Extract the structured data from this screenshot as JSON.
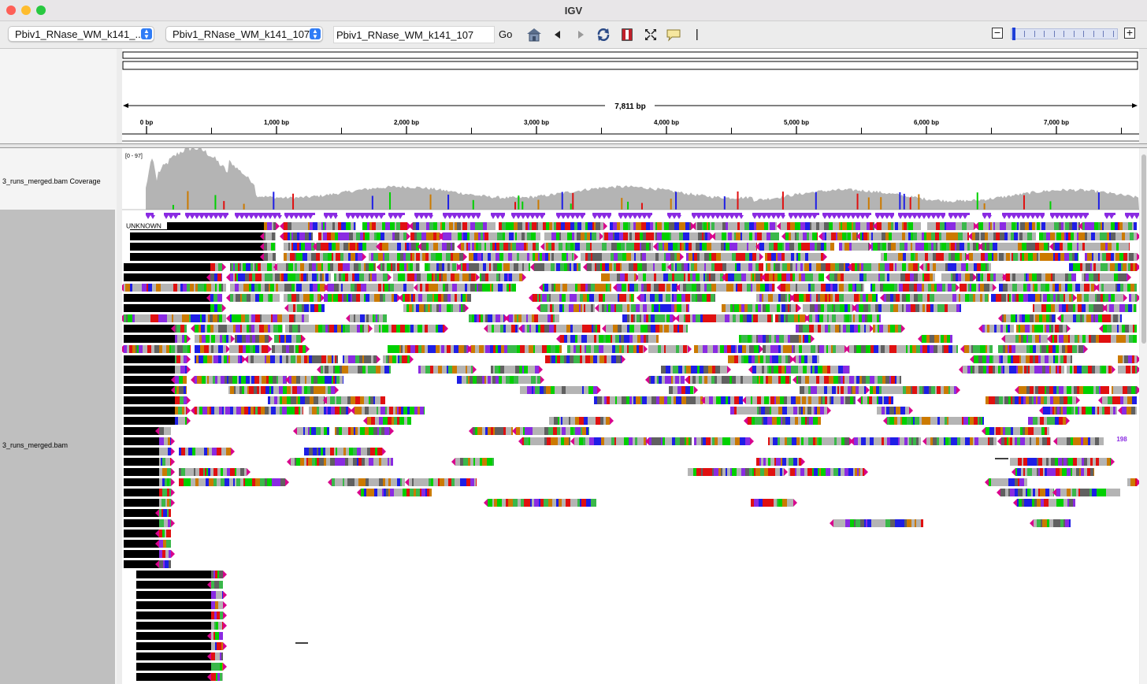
{
  "window": {
    "title": "IGV",
    "traffic_lights": {
      "close": "#fe5f57",
      "minimize": "#febc2e",
      "zoom": "#28c840"
    }
  },
  "toolbar": {
    "genome_combo": "Pbiv1_RNase_WM_k141_...",
    "chromosome_combo": "Pbiv1_RNase_WM_k141_107",
    "locus_input": "Pbiv1_RNase_WM_k141_107",
    "go_label": "Go",
    "icons": [
      "home-icon",
      "back-icon",
      "forward-icon",
      "refresh-icon",
      "region-of-interest-icon",
      "resize-icon",
      "popup-text-icon",
      "ruler-line-icon"
    ],
    "zoom": {
      "minus": "−",
      "plus": "+",
      "level_fraction": 0.0
    }
  },
  "ruler": {
    "span_label": "7,811 bp",
    "ticks": [
      "0 bp",
      "1,000 bp",
      "2,000 bp",
      "3,000 bp",
      "4,000 bp",
      "5,000 bp",
      "6,000 bp",
      "7,000 bp"
    ]
  },
  "tracks": {
    "coverage_name": "3_runs_merged.bam Coverage",
    "coverage_range": "[0 - 97]",
    "alignment_name": "3_runs_merged.bam",
    "group_label": "UNKNOWN",
    "insertion_badge": "198"
  },
  "colors": {
    "coverage": "#b4b4b4",
    "insertion": "#8a2be2",
    "base_A": "#00d000",
    "base_C": "#1e1ee6",
    "base_G": "#cc7a00",
    "base_T": "#e01010",
    "read_gray": "#b4b4b4",
    "clip": "#000000",
    "strand_edge": "#d8008c"
  }
}
